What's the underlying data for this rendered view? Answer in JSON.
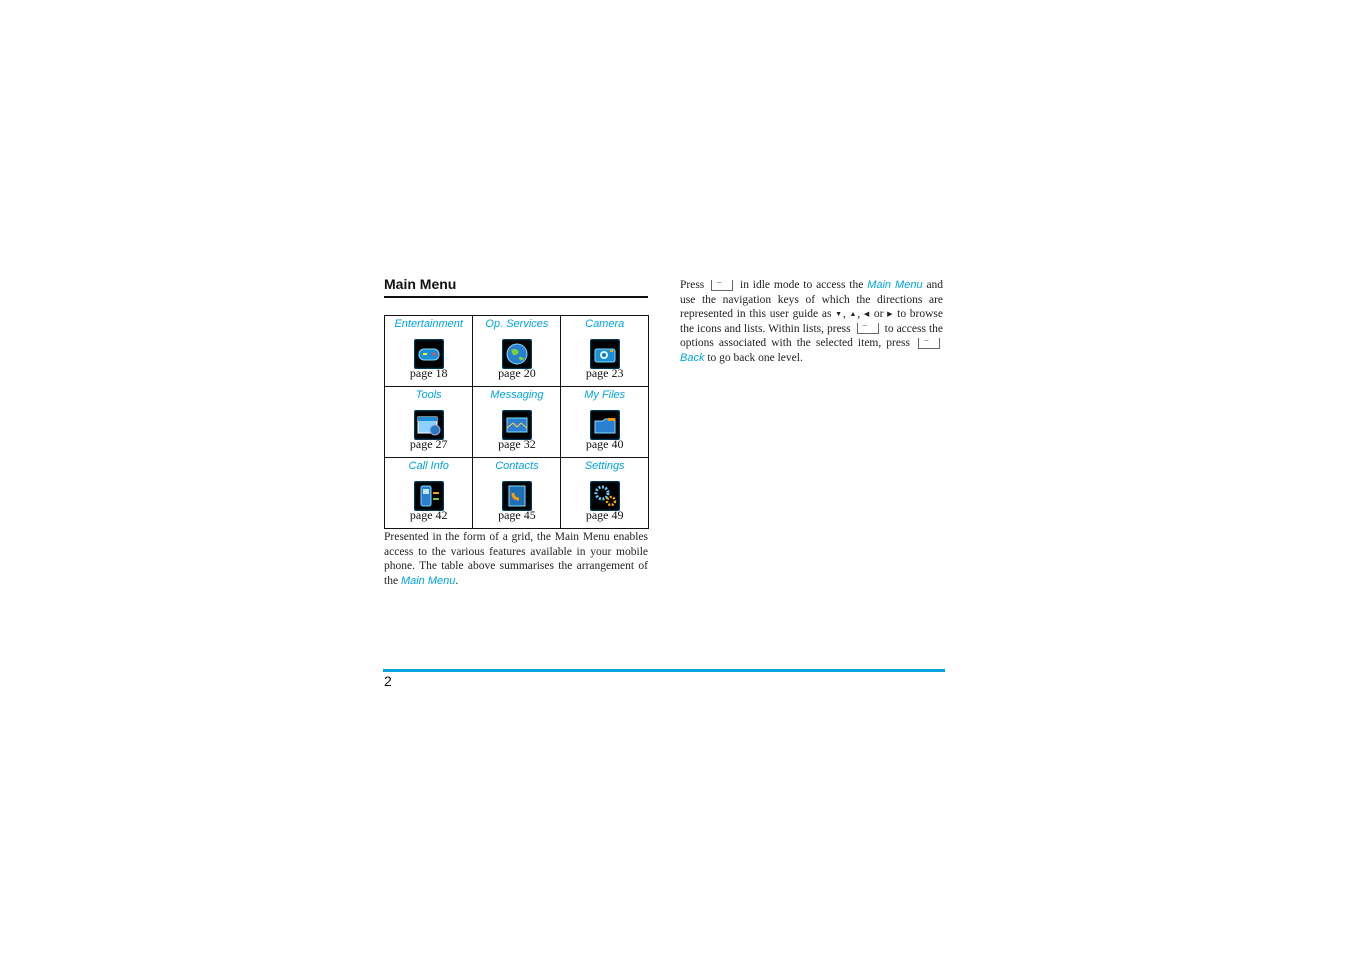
{
  "heading": "Main Menu",
  "grid": [
    {
      "title": "Entertainment",
      "icon": "gamepad-icon",
      "page": "page 18"
    },
    {
      "title": "Op. Services",
      "icon": "globe-icon",
      "page": "page 20"
    },
    {
      "title": "Camera",
      "icon": "camera-icon",
      "page": "page 23"
    },
    {
      "title": "Tools",
      "icon": "calendar-tools-icon",
      "page": "page 27"
    },
    {
      "title": "Messaging",
      "icon": "envelope-icon",
      "page": "page 32"
    },
    {
      "title": "My Files",
      "icon": "folder-icon",
      "page": "page 40"
    },
    {
      "title": "Call Info",
      "icon": "phone-call-icon",
      "page": "page 42"
    },
    {
      "title": "Contacts",
      "icon": "contacts-book-icon",
      "page": "page 45"
    },
    {
      "title": "Settings",
      "icon": "gears-icon",
      "page": "page 49"
    }
  ],
  "left_para": {
    "text": "Presented in the form of a grid, the Main Menu enables access to the various features available in your mobile phone. The table above summarises the arrangement of the",
    "link": "Main Menu",
    "end": "."
  },
  "right_para": {
    "t1": "Press",
    "t2": "in idle mode to access the",
    "link1": "Main Menu",
    "t3": "and use the navigation keys of which the directions are represented in this user guide as",
    "t4": "or",
    "t5": "to browse the icons and lists. Within lists, press",
    "t6": "to access the options associated with the selected item, press",
    "link2": "Back",
    "t7": "to go back one level."
  },
  "footer": {
    "page_number": "2",
    "accent_color": "#00a3e0"
  }
}
